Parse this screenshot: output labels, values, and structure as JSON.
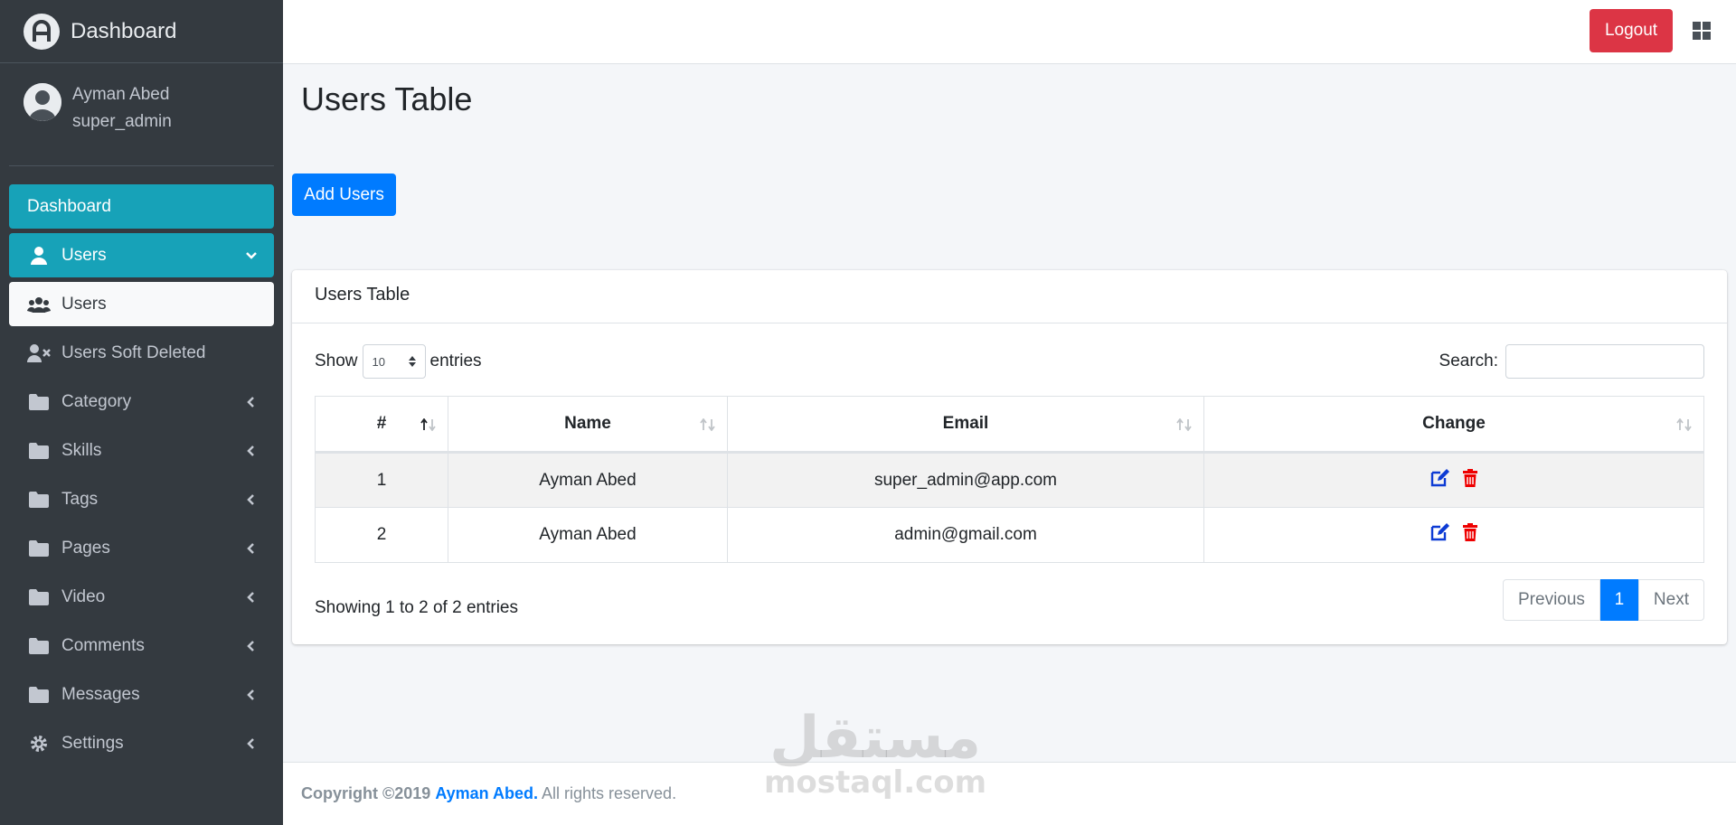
{
  "brand": {
    "title": "Dashboard"
  },
  "user": {
    "name": "Ayman Abed",
    "role": "super_admin"
  },
  "sidebar": {
    "items": [
      {
        "label": "Dashboard",
        "icon": "none"
      },
      {
        "label": "Users",
        "icon": "user-icon"
      },
      {
        "label": "Users",
        "icon": "users-group-icon"
      },
      {
        "label": "Users Soft Deleted",
        "icon": "user-times-icon"
      },
      {
        "label": "Category",
        "icon": "folder-icon"
      },
      {
        "label": "Skills",
        "icon": "folder-icon"
      },
      {
        "label": "Tags",
        "icon": "folder-icon"
      },
      {
        "label": "Pages",
        "icon": "folder-icon"
      },
      {
        "label": "Video",
        "icon": "folder-icon"
      },
      {
        "label": "Comments",
        "icon": "folder-icon"
      },
      {
        "label": "Messages",
        "icon": "folder-icon"
      },
      {
        "label": "Settings",
        "icon": "gear-icon"
      }
    ]
  },
  "header": {
    "logout_label": "Logout"
  },
  "main": {
    "page_title": "Users Table",
    "add_button": "Add Users",
    "card_title": "Users Table",
    "show_label": "Show",
    "entries_label": "entries",
    "page_length": "10",
    "search_label": "Search:",
    "search_value": "",
    "columns": [
      "#",
      "Name",
      "Email",
      "Change"
    ],
    "rows": [
      {
        "id": "1",
        "name": "Ayman Abed",
        "email": "super_admin@app.com"
      },
      {
        "id": "2",
        "name": "Ayman Abed",
        "email": "admin@gmail.com"
      }
    ],
    "info": "Showing 1 to 2 of 2 entries",
    "pagination": {
      "previous": "Previous",
      "current": "1",
      "next": "Next"
    }
  },
  "footer": {
    "copyright": "Copyright ©2019",
    "author": "Ayman Abed.",
    "rights": "All rights reserved."
  },
  "watermark": {
    "arabic": "مستقل",
    "latin": "mostaql.com"
  },
  "colors": {
    "sidebar_bg": "#343a40",
    "active_nav": "#17a2b8",
    "primary": "#007bff",
    "danger": "#dc3545"
  }
}
